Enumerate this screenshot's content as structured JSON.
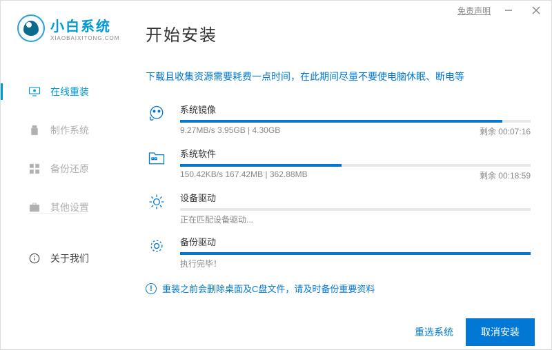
{
  "titlebar": {
    "disclaimer": "免责声明"
  },
  "brand": {
    "name_cn": "小白系统",
    "name_en": "XIAOBAIXITONG.COM"
  },
  "page_title": "开始安装",
  "sidebar": {
    "items": [
      {
        "label": "在线重装"
      },
      {
        "label": "制作系统"
      },
      {
        "label": "备份还原"
      },
      {
        "label": "其他设置"
      },
      {
        "label": "关于我们"
      }
    ]
  },
  "hint": "下载且收集资源需要耗费一点时间，在此期间尽量不要使电脑休眠、断电等",
  "tasks": [
    {
      "title": "系统镜像",
      "detail": "9.27MB/s 3.95GB | 4.30GB",
      "remaining": "剩余 00:07:16",
      "pct": 92
    },
    {
      "title": "系统软件",
      "detail": "150.42KB/s 167.42MB | 362.88MB",
      "remaining": "剩余 00:18:59",
      "pct": 46
    },
    {
      "title": "设备驱动",
      "detail": "正在匹配设备驱动...",
      "remaining": "",
      "pct": 0
    },
    {
      "title": "备份驱动",
      "detail": "执行完毕！",
      "remaining": "",
      "pct": 100
    }
  ],
  "warning": "重装之前会删除桌面及C盘文件，请及时备份重要资料",
  "footer": {
    "reselect": "重选系统",
    "cancel": "取消安装"
  }
}
